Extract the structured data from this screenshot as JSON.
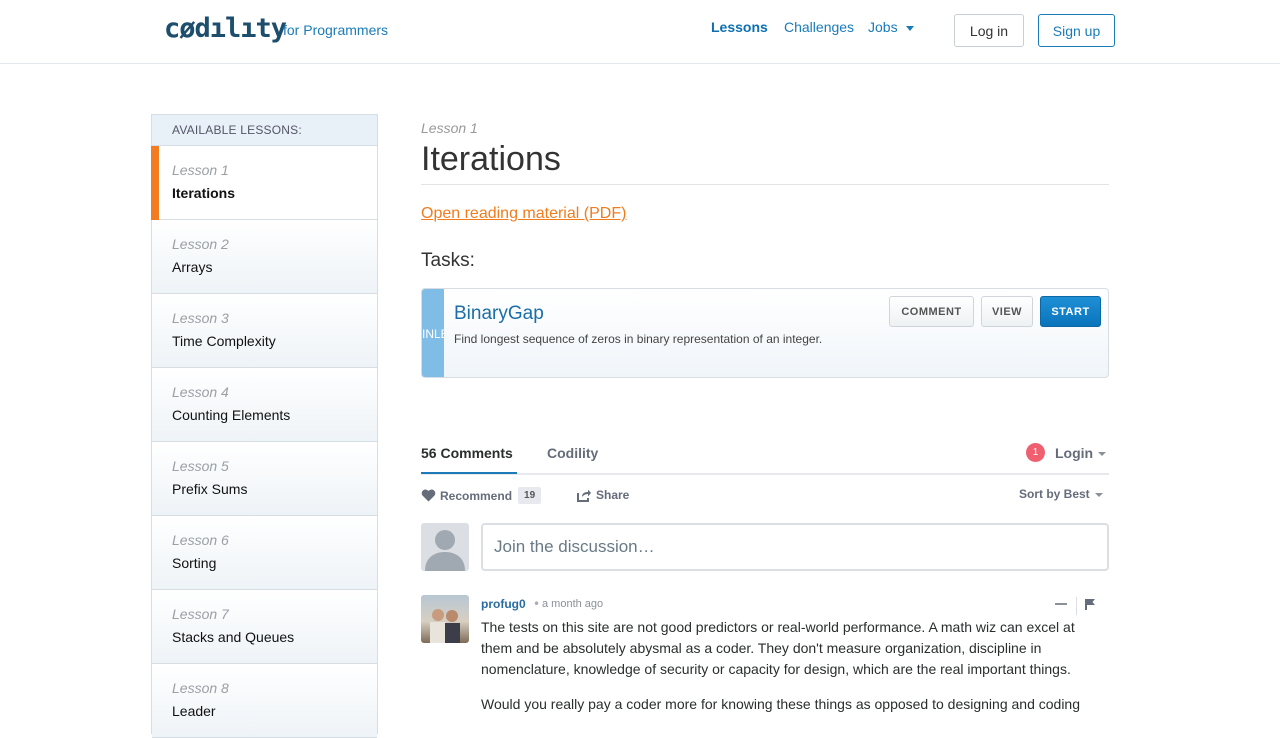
{
  "header": {
    "logo_text": "cødılıty",
    "tagline": "for Programmers",
    "nav": {
      "lessons": "Lessons",
      "challenges": "Challenges",
      "jobs": "Jobs"
    },
    "login": "Log in",
    "signup": "Sign up"
  },
  "sidebar": {
    "heading": "AVAILABLE LESSONS:",
    "lessons": [
      {
        "number": "Lesson 1",
        "name": "Iterations"
      },
      {
        "number": "Lesson 2",
        "name": "Arrays"
      },
      {
        "number": "Lesson 3",
        "name": "Time Complexity"
      },
      {
        "number": "Lesson 4",
        "name": "Counting Elements"
      },
      {
        "number": "Lesson 5",
        "name": "Prefix Sums"
      },
      {
        "number": "Lesson 6",
        "name": "Sorting"
      },
      {
        "number": "Lesson 7",
        "name": "Stacks and Queues"
      },
      {
        "number": "Lesson 8",
        "name": "Leader"
      }
    ]
  },
  "main": {
    "lesson_number": "Lesson 1",
    "title": "Iterations",
    "pdf_link": "Open reading material (PDF)",
    "tasks_label": "Tasks:",
    "task": {
      "side_label": "INLE",
      "name": "BinaryGap",
      "description": "Find longest sequence of zeros in binary representation of an integer.",
      "comment_btn": "COMMENT",
      "view_btn": "VIEW",
      "start_btn": "START"
    }
  },
  "comments": {
    "count_tab": "56 Comments",
    "site_tab": "Codility",
    "notif_count": "1",
    "login": "Login",
    "recommend": "Recommend",
    "recommend_count": "19",
    "share": "Share",
    "sort": "Sort by Best",
    "join_placeholder": "Join the discussion…",
    "first": {
      "author": "profug0",
      "separator": "•",
      "time": "a month ago",
      "paragraph1": "The tests on this site are not good predictors or real-world performance. A math wiz can excel at them and be absolutely abysmal as a coder. They don't measure organization, discipline in nomenclature, knowledge of security or capacity for design, which are the real important things.",
      "paragraph2": "Would you really pay a coder more for knowing these things as opposed to designing and coding"
    }
  },
  "colors": {
    "accent_orange": "#f47c20",
    "link_blue": "#1a7bb9",
    "start_blue": "#0a74bb"
  }
}
